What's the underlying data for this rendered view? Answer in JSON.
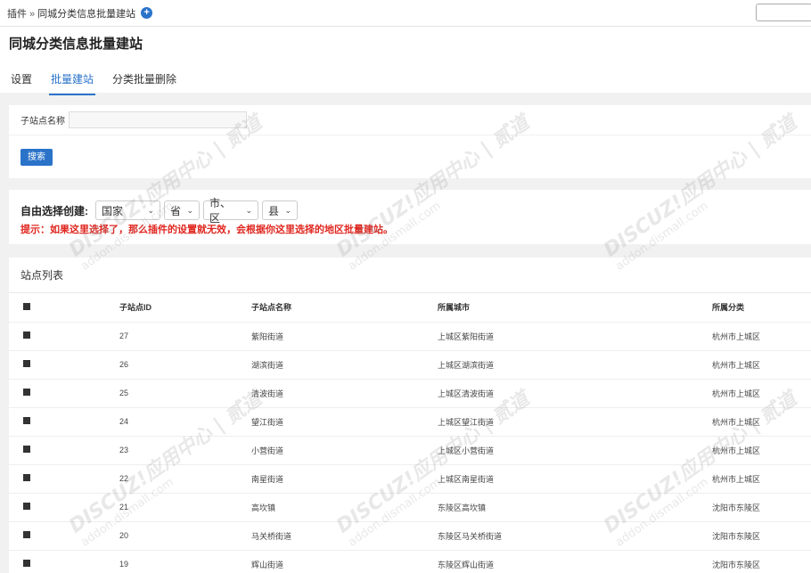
{
  "breadcrumb": {
    "root": "插件",
    "sep": "»",
    "current": "同城分类信息批量建站"
  },
  "page_title": "同城分类信息批量建站",
  "tabs": [
    {
      "label": "设置",
      "active": false
    },
    {
      "label": "批量建站",
      "active": true
    },
    {
      "label": "分类批量删除",
      "active": false
    }
  ],
  "search": {
    "label": "子站点名称",
    "value": "",
    "button": "搜索"
  },
  "region_select": {
    "label": "自由选择创建:",
    "selects": [
      {
        "value": "国家"
      },
      {
        "value": "省"
      },
      {
        "value": "市、区"
      },
      {
        "value": "县"
      }
    ],
    "tip": "提示：如果这里选择了，那么插件的设置就无效，会根据你这里选择的地区批量建站。"
  },
  "site_list": {
    "title": "站点列表",
    "columns": [
      "子站点ID",
      "子站点名称",
      "所属城市",
      "所属分类"
    ],
    "rows": [
      {
        "id": "27",
        "name": "紫阳街道",
        "city": "上城区紫阳街道",
        "category": "杭州市上城区"
      },
      {
        "id": "26",
        "name": "湖滨街道",
        "city": "上城区湖滨街道",
        "category": "杭州市上城区"
      },
      {
        "id": "25",
        "name": "清波街道",
        "city": "上城区清波街道",
        "category": "杭州市上城区"
      },
      {
        "id": "24",
        "name": "望江街道",
        "city": "上城区望江街道",
        "category": "杭州市上城区"
      },
      {
        "id": "23",
        "name": "小营街道",
        "city": "上城区小营街道",
        "category": "杭州市上城区"
      },
      {
        "id": "22",
        "name": "南星街道",
        "city": "上城区南星街道",
        "category": "杭州市上城区"
      },
      {
        "id": "21",
        "name": "高坎镇",
        "city": "东陵区高坎镇",
        "category": "沈阳市东陵区"
      },
      {
        "id": "20",
        "name": "马关桥街道",
        "city": "东陵区马关桥街道",
        "category": "沈阳市东陵区"
      },
      {
        "id": "19",
        "name": "辉山街道",
        "city": "东陵区辉山街道",
        "category": "沈阳市东陵区"
      }
    ]
  },
  "watermark": {
    "line1": "DISCUZ!应用中心 | 贰道",
    "line2": "addon.dismall.com"
  }
}
